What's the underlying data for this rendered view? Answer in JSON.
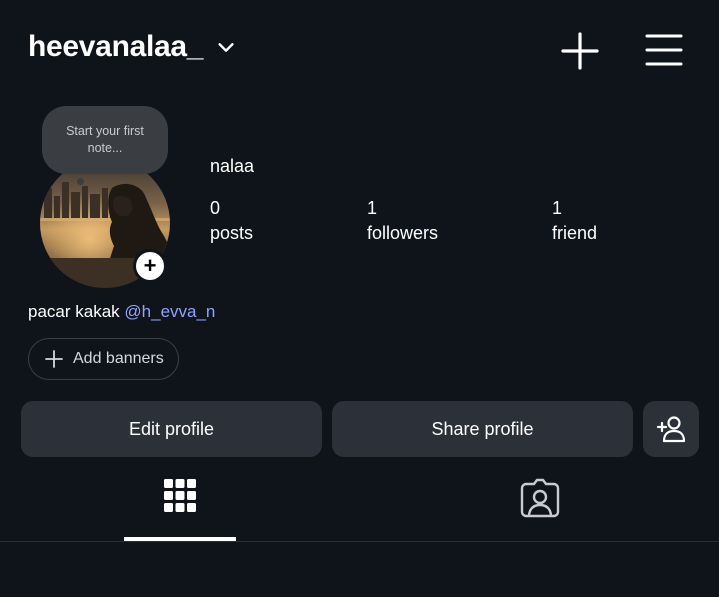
{
  "header": {
    "username": "heevanalaa_",
    "icons": {
      "account_switcher": "chevron-down-icon",
      "create": "plus-icon",
      "menu": "hamburger-menu-icon"
    }
  },
  "profile": {
    "note_placeholder": "Start your first note...",
    "display_name": "nalaa",
    "stats": [
      {
        "value": "0",
        "label": "posts"
      },
      {
        "value": "1",
        "label": "followers"
      },
      {
        "value": "1",
        "label": "friend"
      }
    ],
    "bio": {
      "text": "pacar kakak",
      "mention": "@h_evva_n",
      "mention_color": "#8fa3ff"
    },
    "add_banners_label": "Add banners"
  },
  "actions": {
    "edit_label": "Edit profile",
    "share_label": "Share profile",
    "add_friend_icon": "add-person-icon"
  },
  "tabs": {
    "items": [
      {
        "name": "grid",
        "icon": "grid-icon",
        "active": true
      },
      {
        "name": "tagged",
        "icon": "tagged-person-icon",
        "active": false
      }
    ]
  },
  "colors": {
    "background": "#0f141a",
    "button_bg": "#2c3038",
    "note_bg": "#3a3d42"
  }
}
